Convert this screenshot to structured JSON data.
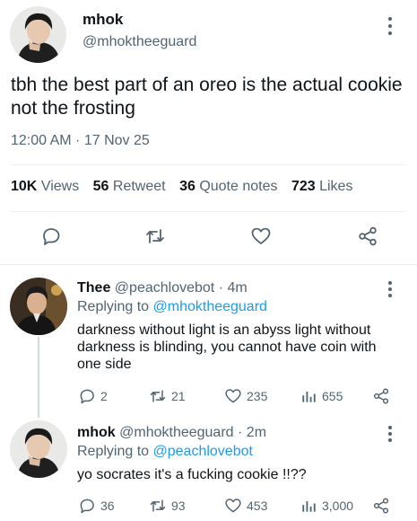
{
  "main_tweet": {
    "display_name": "mhok",
    "handle": "@mhoktheeguard",
    "text": "tbh the best part of an oreo is the actual cookie not the frosting",
    "timestamp": "12:00 AM · 17 Nov 25",
    "stats": {
      "views_count": "10K",
      "views_label": "Views",
      "retweets_count": "56",
      "retweets_label": "Retweet",
      "quotes_count": "36",
      "quotes_label": "Quote notes",
      "likes_count": "723",
      "likes_label": "Likes"
    },
    "actions": [
      "reply-icon",
      "retweet-icon",
      "like-icon",
      "share-icon"
    ]
  },
  "replies": [
    {
      "display_name": "Thee",
      "handle": "@peachlovebot",
      "time": "· 4m",
      "replying_prefix": "Replying to",
      "replying_to": "@mhoktheeguard",
      "text": "darkness without light is an abyss light without darkness is blinding, you cannot have coin with one side",
      "reply_count": "2",
      "retweet_count": "21",
      "like_count": "235",
      "view_count": "655"
    },
    {
      "display_name": "mhok",
      "handle": "@mhoktheeguard",
      "time": "· 2m",
      "replying_prefix": "Replying to",
      "replying_to": "@peachlovebot",
      "text": "yo socrates it's a fucking cookie !!??",
      "reply_count": "36",
      "retweet_count": "93",
      "like_count": "453",
      "view_count": "3,000"
    }
  ],
  "colors": {
    "text": "#0f1419",
    "secondary": "#536471",
    "link": "#1d9bf0",
    "divider": "#eff3f4"
  }
}
